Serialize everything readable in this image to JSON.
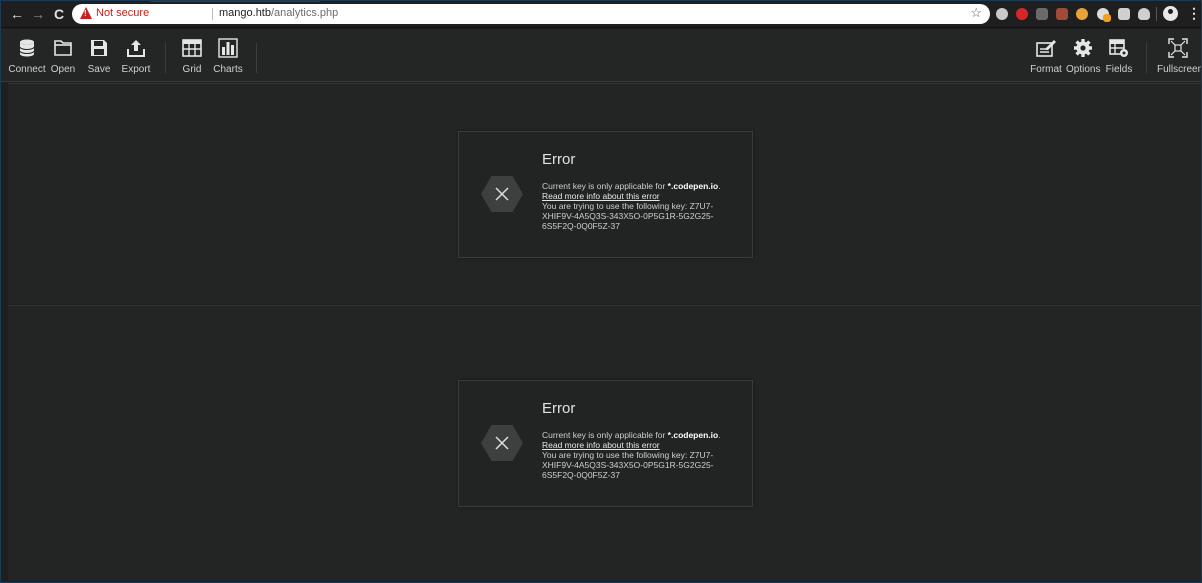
{
  "browser": {
    "not_secure": "Not secure",
    "url_host": "mango.htb",
    "url_path": "/analytics.php",
    "back": "←",
    "forward": "→",
    "reload": "C",
    "star": "☆",
    "menu": "⋮"
  },
  "toolbar": {
    "connect": "Connect",
    "open": "Open",
    "save": "Save",
    "export": "Export",
    "grid": "Grid",
    "charts": "Charts",
    "format": "Format",
    "options": "Options",
    "fields": "Fields",
    "fullscreen": "Fullscreen"
  },
  "errors": [
    {
      "title": "Error",
      "line1_prefix": "Current key is only applicable for ",
      "line1_domain": "*.codepen.io",
      "line1_suffix": ".",
      "link": "Read more info about this error",
      "key_text": "You are trying to use the following key: Z7U7-XHIF9V-4A5Q3S-343X5O-0P5G1R-5G2G25-6S5F2Q-0Q0F5Z-37"
    },
    {
      "title": "Error",
      "line1_prefix": "Current key is only applicable for ",
      "line1_domain": "*.codepen.io",
      "line1_suffix": ".",
      "link": "Read more info about this error",
      "key_text": "You are trying to use the following key: Z7U7-XHIF9V-4A5Q3S-343X5O-0P5G1R-5G2G25-6S5F2Q-0Q0F5Z-37"
    }
  ]
}
